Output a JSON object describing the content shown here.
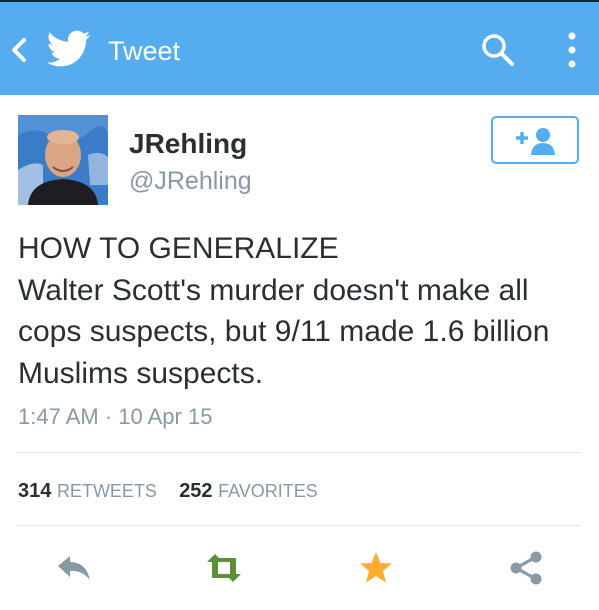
{
  "header": {
    "title": "Tweet",
    "background_color": "#55acee",
    "icons": [
      "back-icon",
      "twitter-bird-icon",
      "search-icon",
      "overflow-menu-icon"
    ]
  },
  "author": {
    "display_name": "JRehling",
    "handle": "@JRehling",
    "follow_icon": "follow-user-icon"
  },
  "tweet": {
    "lines": [
      "HOW TO GENERALIZE",
      "Walter Scott's murder doesn't make all",
      "cops suspects, but 9/11 made 1.6 billion",
      "Muslims suspects."
    ],
    "timestamp": "1:47 AM · 10 Apr 15"
  },
  "stats": {
    "retweets_count": "314",
    "retweets_label": "RETWEETS",
    "favorites_count": "252",
    "favorites_label": "FAVORITES"
  },
  "actions": {
    "reply_icon": "reply-icon",
    "retweet_icon": "retweet-icon",
    "favorite_icon": "star-icon",
    "share_icon": "share-icon",
    "retweet_color": "#5c913b",
    "favorite_color": "#ffac33",
    "inactive_color": "#8899a6"
  }
}
